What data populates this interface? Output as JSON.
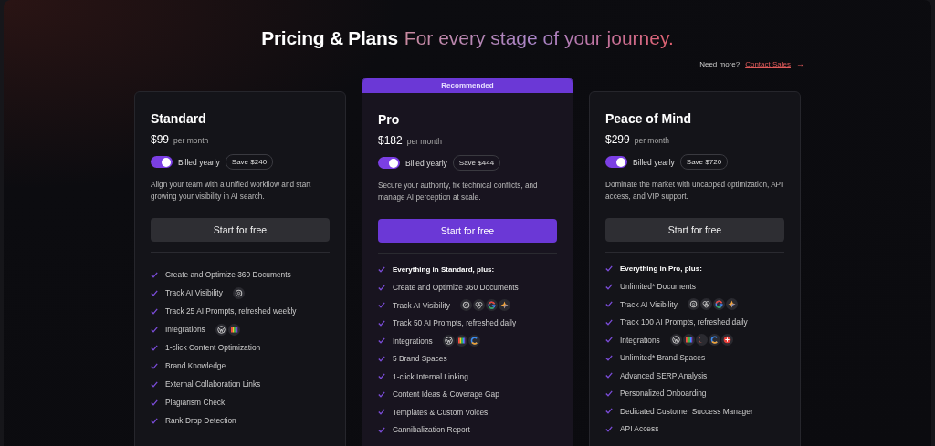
{
  "header": {
    "title": "Pricing & Plans",
    "subtitle": "For every stage of your journey.",
    "contact_prompt": "Need more?",
    "contact_link": "Contact Sales",
    "contact_arrow": "→"
  },
  "plans": [
    {
      "name": "Standard",
      "price": "$99",
      "period": "per month",
      "featured": false,
      "billing": {
        "label": "Billed yearly",
        "on": true
      },
      "save": "Save $240",
      "description": "Align your team with a unified workflow and start growing your visibility in AI search.",
      "button": "Start for free",
      "features": [
        {
          "text": "Create and Optimize 360 Documents"
        },
        {
          "text": "Track AI Visibility",
          "logos": [
            {
              "kind": "spiral"
            }
          ]
        },
        {
          "text": "Track 25 AI Prompts, refreshed weekly"
        },
        {
          "text": "Integrations",
          "logos": [
            {
              "kind": "w"
            },
            {
              "kind": "rainbow"
            }
          ]
        },
        {
          "text": "1-click Content Optimization"
        },
        {
          "text": "Brand Knowledge"
        },
        {
          "text": "External Collaboration Links"
        },
        {
          "text": "Plagiarism Check"
        },
        {
          "text": "Rank Drop Detection"
        }
      ]
    },
    {
      "name": "Pro",
      "badge": "Recommended",
      "price": "$182",
      "period": "per month",
      "featured": true,
      "billing": {
        "label": "Billed yearly",
        "on": true
      },
      "save": "Save $444",
      "description": "Secure your authority, fix technical conflicts, and manage AI perception at scale.",
      "button": "Start for free",
      "features": [
        {
          "text": "Everything in Standard, plus:",
          "kind": "heading"
        },
        {
          "text": "Create and Optimize 360 Documents"
        },
        {
          "text": "Track AI Visibility",
          "logos": [
            {
              "kind": "spiral"
            },
            {
              "kind": "knot"
            },
            {
              "kind": "g"
            },
            {
              "kind": "spark"
            }
          ]
        },
        {
          "text": "Track 50 AI Prompts, refreshed daily"
        },
        {
          "text": "Integrations",
          "logos": [
            {
              "kind": "w"
            },
            {
              "kind": "rainbow"
            },
            {
              "kind": "c"
            }
          ]
        },
        {
          "text": "5 Brand Spaces"
        },
        {
          "text": "1-click Internal Linking"
        },
        {
          "text": "Content Ideas & Coverage Gap"
        },
        {
          "text": "Templates & Custom Voices"
        },
        {
          "text": "Cannibalization Report"
        }
      ]
    },
    {
      "name": "Peace of Mind",
      "price": "$299",
      "period": "per month",
      "featured": false,
      "billing": {
        "label": "Billed yearly",
        "on": true
      },
      "save": "Save $720",
      "description": "Dominate the market with uncapped optimization, API access, and VIP support.",
      "button": "Start for free",
      "features": [
        {
          "text": "Everything in Pro, plus:",
          "kind": "heading"
        },
        {
          "text": "Unlimited* Documents"
        },
        {
          "text": "Track AI Visibility",
          "logos": [
            {
              "kind": "spiral"
            },
            {
              "kind": "knot"
            },
            {
              "kind": "g"
            },
            {
              "kind": "spark"
            }
          ]
        },
        {
          "text": "Track 100 AI Prompts, refreshed daily"
        },
        {
          "text": "Integrations",
          "logos": [
            {
              "kind": "w"
            },
            {
              "kind": "rainbow"
            },
            {
              "kind": "crescent"
            },
            {
              "kind": "c"
            },
            {
              "kind": "burst"
            }
          ]
        },
        {
          "text": "Unlimited* Brand Spaces"
        },
        {
          "text": "Advanced SERP Analysis"
        },
        {
          "text": "Personalized Onboarding"
        },
        {
          "text": "Dedicated Customer Success Manager"
        },
        {
          "text": "API Access"
        }
      ]
    }
  ]
}
